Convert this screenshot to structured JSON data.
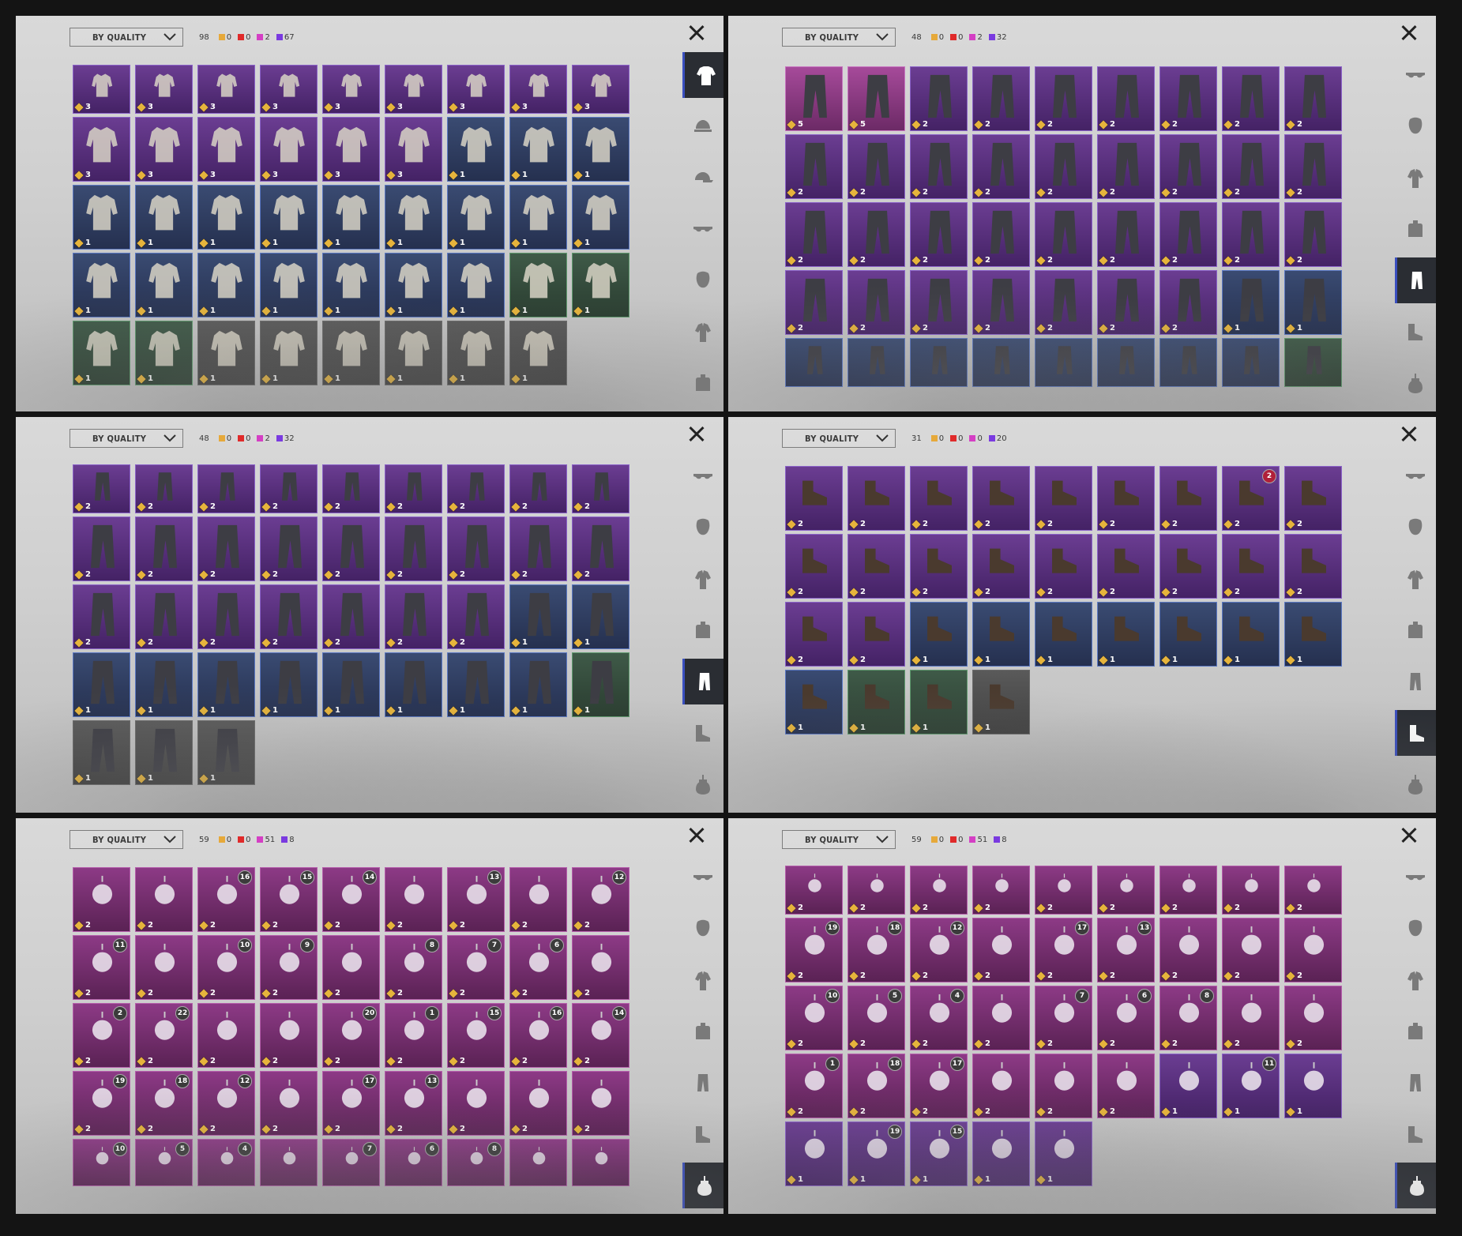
{
  "colors": {
    "gold": "#e6a93a",
    "red": "#e02a2a",
    "pink": "#d43fc4",
    "purple": "#7a3ae0"
  },
  "panels": [
    {
      "dropdown": "BY QUALITY",
      "total": "98",
      "gold": "0",
      "red": "0",
      "pink": "2",
      "purple": "67",
      "active_category": "tops",
      "items": [
        {
          "q": "purple",
          "n": "3"
        },
        {
          "q": "purple",
          "n": "3"
        },
        {
          "q": "purple",
          "n": "3"
        },
        {
          "q": "purple",
          "n": "3"
        },
        {
          "q": "purple",
          "n": "3"
        },
        {
          "q": "purple",
          "n": "3"
        },
        {
          "q": "purple",
          "n": "3"
        },
        {
          "q": "purple",
          "n": "3"
        },
        {
          "q": "purple",
          "n": "3"
        },
        {
          "q": "purple",
          "n": "3"
        },
        {
          "q": "purple",
          "n": "3"
        },
        {
          "q": "purple",
          "n": "3"
        },
        {
          "q": "purple",
          "n": "3"
        },
        {
          "q": "purple",
          "n": "3"
        },
        {
          "q": "purple",
          "n": "3"
        },
        {
          "q": "blue",
          "n": "1"
        },
        {
          "q": "blue",
          "n": "1"
        },
        {
          "q": "blue",
          "n": "1"
        },
        {
          "q": "blue",
          "n": "1"
        },
        {
          "q": "blue",
          "n": "1"
        },
        {
          "q": "blue",
          "n": "1"
        },
        {
          "q": "blue",
          "n": "1"
        },
        {
          "q": "blue",
          "n": "1"
        },
        {
          "q": "blue",
          "n": "1"
        },
        {
          "q": "blue",
          "n": "1"
        },
        {
          "q": "blue",
          "n": "1"
        },
        {
          "q": "blue",
          "n": "1"
        },
        {
          "q": "blue",
          "n": "1"
        },
        {
          "q": "blue",
          "n": "1"
        },
        {
          "q": "blue",
          "n": "1"
        },
        {
          "q": "blue",
          "n": "1"
        },
        {
          "q": "blue",
          "n": "1"
        },
        {
          "q": "blue",
          "n": "1"
        },
        {
          "q": "blue",
          "n": "1"
        },
        {
          "q": "green",
          "n": "1"
        },
        {
          "q": "green",
          "n": "1"
        },
        {
          "q": "green",
          "n": "1"
        },
        {
          "q": "green",
          "n": "1"
        },
        {
          "q": "gray",
          "n": "1"
        },
        {
          "q": "gray",
          "n": "1"
        },
        {
          "q": "gray",
          "n": "1"
        },
        {
          "q": "gray",
          "n": "1"
        },
        {
          "q": "gray",
          "n": "1"
        },
        {
          "q": "gray",
          "n": "1"
        }
      ]
    },
    {
      "dropdown": "BY QUALITY",
      "total": "48",
      "gold": "0",
      "red": "0",
      "pink": "2",
      "purple": "32",
      "active_category": "pants",
      "items": [
        {
          "q": "pink",
          "n": "5"
        },
        {
          "q": "pink",
          "n": "5"
        },
        {
          "q": "purple",
          "n": "2"
        },
        {
          "q": "purple",
          "n": "2"
        },
        {
          "q": "purple",
          "n": "2"
        },
        {
          "q": "purple",
          "n": "2"
        },
        {
          "q": "purple",
          "n": "2"
        },
        {
          "q": "purple",
          "n": "2"
        },
        {
          "q": "purple",
          "n": "2"
        },
        {
          "q": "purple",
          "n": "2"
        },
        {
          "q": "purple",
          "n": "2"
        },
        {
          "q": "purple",
          "n": "2"
        },
        {
          "q": "purple",
          "n": "2"
        },
        {
          "q": "purple",
          "n": "2"
        },
        {
          "q": "purple",
          "n": "2"
        },
        {
          "q": "purple",
          "n": "2"
        },
        {
          "q": "purple",
          "n": "2"
        },
        {
          "q": "purple",
          "n": "2"
        },
        {
          "q": "purple",
          "n": "2"
        },
        {
          "q": "purple",
          "n": "2"
        },
        {
          "q": "purple",
          "n": "2"
        },
        {
          "q": "purple",
          "n": "2"
        },
        {
          "q": "purple",
          "n": "2"
        },
        {
          "q": "purple",
          "n": "2"
        },
        {
          "q": "purple",
          "n": "2"
        },
        {
          "q": "purple",
          "n": "2"
        },
        {
          "q": "purple",
          "n": "2"
        },
        {
          "q": "purple",
          "n": "2"
        },
        {
          "q": "purple",
          "n": "2"
        },
        {
          "q": "purple",
          "n": "2"
        },
        {
          "q": "purple",
          "n": "2"
        },
        {
          "q": "purple",
          "n": "2"
        },
        {
          "q": "purple",
          "n": "2"
        },
        {
          "q": "purple",
          "n": "2"
        },
        {
          "q": "blue",
          "n": "1"
        },
        {
          "q": "blue",
          "n": "1"
        },
        {
          "q": "blue",
          "n": ""
        },
        {
          "q": "blue",
          "n": ""
        },
        {
          "q": "blue",
          "n": ""
        },
        {
          "q": "blue",
          "n": ""
        },
        {
          "q": "blue",
          "n": ""
        },
        {
          "q": "blue",
          "n": ""
        },
        {
          "q": "blue",
          "n": ""
        },
        {
          "q": "blue",
          "n": ""
        },
        {
          "q": "green",
          "n": ""
        }
      ]
    },
    {
      "dropdown": "BY QUALITY",
      "total": "48",
      "gold": "0",
      "red": "0",
      "pink": "2",
      "purple": "32",
      "active_category": "pants",
      "items": [
        {
          "q": "purple",
          "n": "2"
        },
        {
          "q": "purple",
          "n": "2"
        },
        {
          "q": "purple",
          "n": "2"
        },
        {
          "q": "purple",
          "n": "2"
        },
        {
          "q": "purple",
          "n": "2"
        },
        {
          "q": "purple",
          "n": "2"
        },
        {
          "q": "purple",
          "n": "2"
        },
        {
          "q": "purple",
          "n": "2"
        },
        {
          "q": "purple",
          "n": "2"
        },
        {
          "q": "purple",
          "n": "2"
        },
        {
          "q": "purple",
          "n": "2"
        },
        {
          "q": "purple",
          "n": "2"
        },
        {
          "q": "purple",
          "n": "2"
        },
        {
          "q": "purple",
          "n": "2"
        },
        {
          "q": "purple",
          "n": "2"
        },
        {
          "q": "purple",
          "n": "2"
        },
        {
          "q": "purple",
          "n": "2"
        },
        {
          "q": "purple",
          "n": "2"
        },
        {
          "q": "purple",
          "n": "2"
        },
        {
          "q": "purple",
          "n": "2"
        },
        {
          "q": "purple",
          "n": "2"
        },
        {
          "q": "purple",
          "n": "2"
        },
        {
          "q": "purple",
          "n": "2"
        },
        {
          "q": "purple",
          "n": "2"
        },
        {
          "q": "purple",
          "n": "2"
        },
        {
          "q": "blue",
          "n": "1"
        },
        {
          "q": "blue",
          "n": "1"
        },
        {
          "q": "blue",
          "n": "1"
        },
        {
          "q": "blue",
          "n": "1"
        },
        {
          "q": "blue",
          "n": "1"
        },
        {
          "q": "blue",
          "n": "1"
        },
        {
          "q": "blue",
          "n": "1"
        },
        {
          "q": "blue",
          "n": "1"
        },
        {
          "q": "blue",
          "n": "1"
        },
        {
          "q": "blue",
          "n": "1"
        },
        {
          "q": "green",
          "n": "1"
        },
        {
          "q": "gray",
          "n": "1"
        },
        {
          "q": "gray",
          "n": "1"
        },
        {
          "q": "gray",
          "n": "1"
        }
      ]
    },
    {
      "dropdown": "BY QUALITY",
      "total": "31",
      "gold": "0",
      "red": "0",
      "pink": "0",
      "purple": "20",
      "active_category": "shoes",
      "items": [
        {
          "q": "purple",
          "n": "2"
        },
        {
          "q": "purple",
          "n": "2"
        },
        {
          "q": "purple",
          "n": "2"
        },
        {
          "q": "purple",
          "n": "2"
        },
        {
          "q": "purple",
          "n": "2"
        },
        {
          "q": "purple",
          "n": "2"
        },
        {
          "q": "purple",
          "n": "2"
        },
        {
          "q": "purple",
          "n": "2",
          "lvl": "2",
          "red": true
        },
        {
          "q": "purple",
          "n": "2"
        },
        {
          "q": "purple",
          "n": "2"
        },
        {
          "q": "purple",
          "n": "2"
        },
        {
          "q": "purple",
          "n": "2"
        },
        {
          "q": "purple",
          "n": "2"
        },
        {
          "q": "purple",
          "n": "2"
        },
        {
          "q": "purple",
          "n": "2"
        },
        {
          "q": "purple",
          "n": "2"
        },
        {
          "q": "purple",
          "n": "2"
        },
        {
          "q": "purple",
          "n": "2"
        },
        {
          "q": "purple",
          "n": "2"
        },
        {
          "q": "purple",
          "n": "2"
        },
        {
          "q": "blue",
          "n": "1"
        },
        {
          "q": "blue",
          "n": "1"
        },
        {
          "q": "blue",
          "n": "1"
        },
        {
          "q": "blue",
          "n": "1"
        },
        {
          "q": "blue",
          "n": "1"
        },
        {
          "q": "blue",
          "n": "1"
        },
        {
          "q": "blue",
          "n": "1"
        },
        {
          "q": "blue",
          "n": "1"
        },
        {
          "q": "green",
          "n": "1"
        },
        {
          "q": "green",
          "n": "1"
        },
        {
          "q": "gray",
          "n": "1"
        }
      ]
    },
    {
      "dropdown": "BY QUALITY",
      "total": "59",
      "gold": "0",
      "red": "0",
      "pink": "51",
      "purple": "8",
      "active_category": "charms",
      "items": [
        {
          "q": "magenta",
          "n": "2"
        },
        {
          "q": "magenta",
          "n": "2"
        },
        {
          "q": "magenta",
          "n": "2",
          "lvl": "16"
        },
        {
          "q": "magenta",
          "n": "2",
          "lvl": "15"
        },
        {
          "q": "magenta",
          "n": "2",
          "lvl": "14"
        },
        {
          "q": "magenta",
          "n": "2"
        },
        {
          "q": "magenta",
          "n": "2",
          "lvl": "13"
        },
        {
          "q": "magenta",
          "n": "2"
        },
        {
          "q": "magenta",
          "n": "2",
          "lvl": "12"
        },
        {
          "q": "magenta",
          "n": "2",
          "lvl": "11"
        },
        {
          "q": "magenta",
          "n": "2"
        },
        {
          "q": "magenta",
          "n": "2",
          "lvl": "10"
        },
        {
          "q": "magenta",
          "n": "2",
          "lvl": "9"
        },
        {
          "q": "magenta",
          "n": "2"
        },
        {
          "q": "magenta",
          "n": "2",
          "lvl": "8"
        },
        {
          "q": "magenta",
          "n": "2",
          "lvl": "7"
        },
        {
          "q": "magenta",
          "n": "2",
          "lvl": "6"
        },
        {
          "q": "magenta",
          "n": "2"
        },
        {
          "q": "magenta",
          "n": "2",
          "lvl": "2"
        },
        {
          "q": "magenta",
          "n": "2",
          "lvl": "22"
        },
        {
          "q": "magenta",
          "n": "2"
        },
        {
          "q": "magenta",
          "n": "2"
        },
        {
          "q": "magenta",
          "n": "2",
          "lvl": "20"
        },
        {
          "q": "magenta",
          "n": "2",
          "lvl": "1"
        },
        {
          "q": "magenta",
          "n": "2",
          "lvl": "15"
        },
        {
          "q": "magenta",
          "n": "2",
          "lvl": "16"
        },
        {
          "q": "magenta",
          "n": "2",
          "lvl": "14"
        },
        {
          "q": "magenta",
          "n": "2",
          "lvl": "19"
        },
        {
          "q": "magenta",
          "n": "2",
          "lvl": "18"
        },
        {
          "q": "magenta",
          "n": "2",
          "lvl": "12"
        },
        {
          "q": "magenta",
          "n": "2"
        },
        {
          "q": "magenta",
          "n": "2",
          "lvl": "17"
        },
        {
          "q": "magenta",
          "n": "2",
          "lvl": "13"
        },
        {
          "q": "magenta",
          "n": "2"
        },
        {
          "q": "magenta",
          "n": "2"
        },
        {
          "q": "magenta",
          "n": "2"
        },
        {
          "q": "magenta",
          "n": "",
          "lvl": "10"
        },
        {
          "q": "magenta",
          "n": "",
          "lvl": "5"
        },
        {
          "q": "magenta",
          "n": "",
          "lvl": "4"
        },
        {
          "q": "magenta",
          "n": ""
        },
        {
          "q": "magenta",
          "n": "",
          "lvl": "7"
        },
        {
          "q": "magenta",
          "n": "",
          "lvl": "6"
        },
        {
          "q": "magenta",
          "n": "",
          "lvl": "8"
        },
        {
          "q": "magenta",
          "n": ""
        },
        {
          "q": "magenta",
          "n": ""
        }
      ]
    },
    {
      "dropdown": "BY QUALITY",
      "total": "59",
      "gold": "0",
      "red": "0",
      "pink": "51",
      "purple": "8",
      "active_category": "charms",
      "items": [
        {
          "q": "magenta",
          "n": "2"
        },
        {
          "q": "magenta",
          "n": "2"
        },
        {
          "q": "magenta",
          "n": "2"
        },
        {
          "q": "magenta",
          "n": "2"
        },
        {
          "q": "magenta",
          "n": "2"
        },
        {
          "q": "magenta",
          "n": "2"
        },
        {
          "q": "magenta",
          "n": "2"
        },
        {
          "q": "magenta",
          "n": "2"
        },
        {
          "q": "magenta",
          "n": "2"
        },
        {
          "q": "magenta",
          "n": "2",
          "lvl": "19"
        },
        {
          "q": "magenta",
          "n": "2",
          "lvl": "18"
        },
        {
          "q": "magenta",
          "n": "2",
          "lvl": "12"
        },
        {
          "q": "magenta",
          "n": "2"
        },
        {
          "q": "magenta",
          "n": "2",
          "lvl": "17"
        },
        {
          "q": "magenta",
          "n": "2",
          "lvl": "13"
        },
        {
          "q": "magenta",
          "n": "2"
        },
        {
          "q": "magenta",
          "n": "2"
        },
        {
          "q": "magenta",
          "n": "2"
        },
        {
          "q": "magenta",
          "n": "2",
          "lvl": "10"
        },
        {
          "q": "magenta",
          "n": "2",
          "lvl": "5"
        },
        {
          "q": "magenta",
          "n": "2",
          "lvl": "4"
        },
        {
          "q": "magenta",
          "n": "2"
        },
        {
          "q": "magenta",
          "n": "2",
          "lvl": "7"
        },
        {
          "q": "magenta",
          "n": "2",
          "lvl": "6"
        },
        {
          "q": "magenta",
          "n": "2",
          "lvl": "8"
        },
        {
          "q": "magenta",
          "n": "2"
        },
        {
          "q": "magenta",
          "n": "2"
        },
        {
          "q": "magenta",
          "n": "2",
          "lvl": "1"
        },
        {
          "q": "magenta",
          "n": "2",
          "lvl": "18"
        },
        {
          "q": "magenta",
          "n": "2",
          "lvl": "17"
        },
        {
          "q": "magenta",
          "n": "2"
        },
        {
          "q": "magenta",
          "n": "2"
        },
        {
          "q": "magenta",
          "n": "2"
        },
        {
          "q": "purple",
          "n": "1"
        },
        {
          "q": "purple",
          "n": "1",
          "lvl": "11"
        },
        {
          "q": "purple",
          "n": "1"
        },
        {
          "q": "purple",
          "n": "1"
        },
        {
          "q": "purple",
          "n": "1",
          "lvl": "19"
        },
        {
          "q": "purple",
          "n": "1",
          "lvl": "15"
        },
        {
          "q": "purple",
          "n": "1"
        },
        {
          "q": "purple",
          "n": "1"
        }
      ]
    }
  ],
  "categories": {
    "top": [
      "tops",
      "hats",
      "caps",
      "glasses",
      "masks",
      "shirts",
      "backpacks"
    ],
    "bottom": [
      "glasses",
      "masks",
      "shirts",
      "backpacks",
      "pants",
      "shoes",
      "charms"
    ]
  }
}
